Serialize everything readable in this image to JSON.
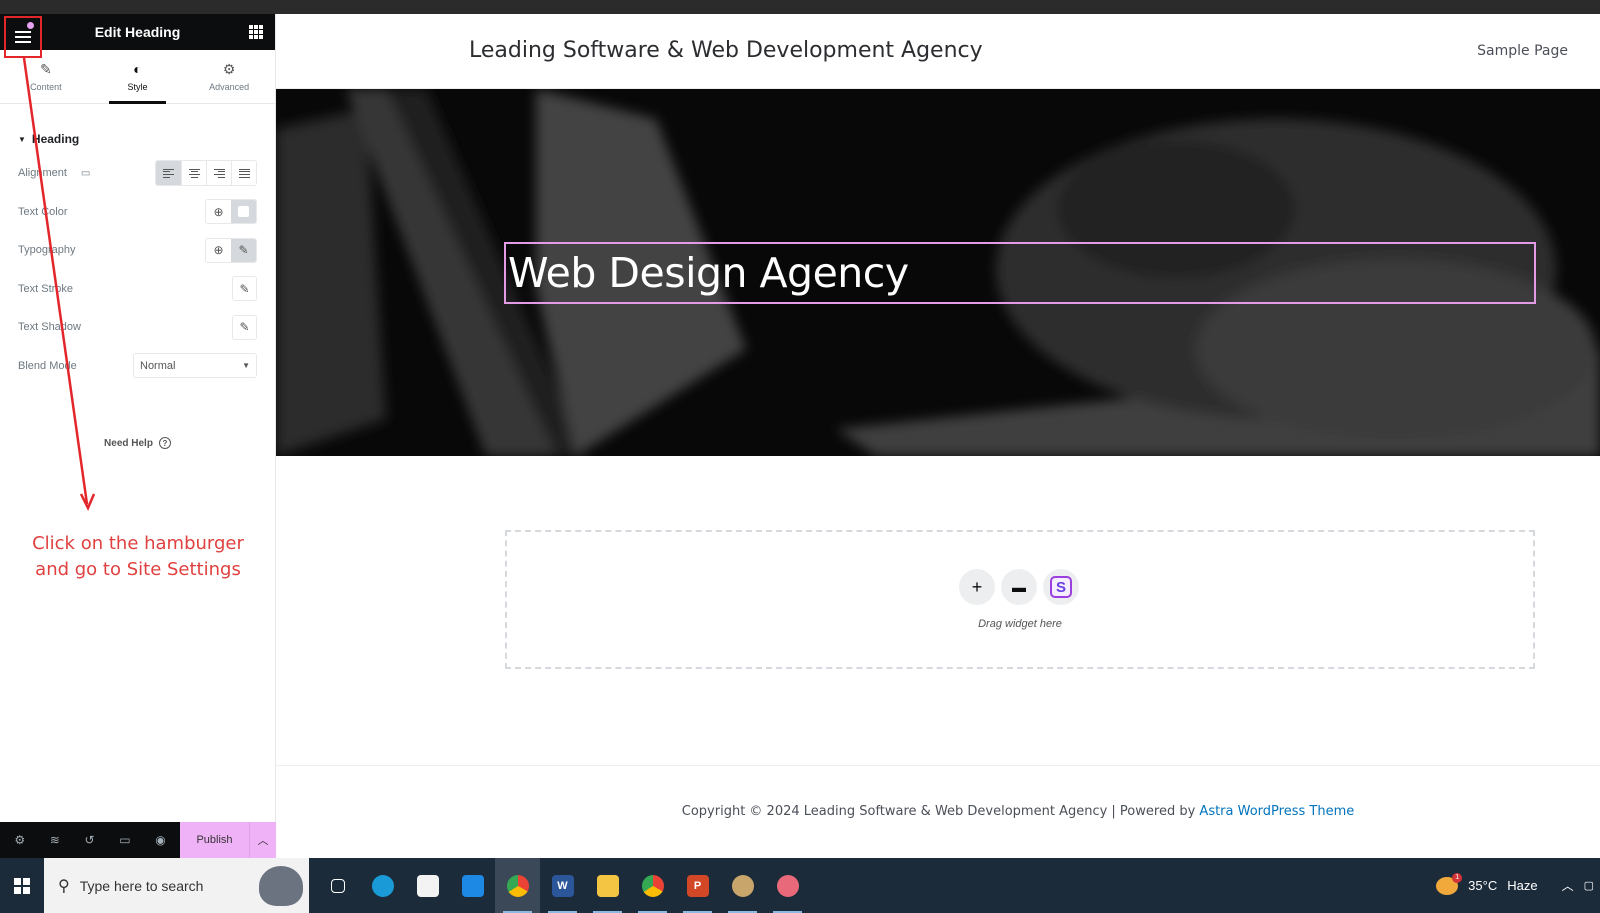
{
  "panel": {
    "title": "Edit Heading",
    "tabs": [
      {
        "label": "Content",
        "icon": "pencil-icon"
      },
      {
        "label": "Style",
        "icon": "half-circle-icon"
      },
      {
        "label": "Advanced",
        "icon": "gear-icon"
      }
    ],
    "active_tab": "Style",
    "section": "Heading",
    "controls": {
      "alignment": "Alignment",
      "text_color": "Text Color",
      "typography": "Typography",
      "text_stroke": "Text Stroke",
      "text_shadow": "Text Shadow",
      "blend_mode": "Blend Mode",
      "blend_mode_value": "Normal"
    },
    "need_help": "Need Help",
    "footer": {
      "publish": "Publish"
    }
  },
  "annotation": {
    "line1": "Click on the hamburger",
    "line2": "and go to Site Settings",
    "color": "#e0403f"
  },
  "site": {
    "title": "Leading Software & Web Development Agency",
    "nav": [
      "Sample Page"
    ],
    "hero_heading": "Web Design Agency",
    "dropzone_text": "Drag widget here",
    "footer_prefix": "Copyright © 2024 Leading Software & Web Development Agency | Powered by ",
    "footer_link": "Astra WordPress Theme"
  },
  "taskbar": {
    "search_placeholder": "Type here to search",
    "apps": [
      "Task View",
      "Edge",
      "Microsoft Store",
      "Mail",
      "Chrome",
      "Word",
      "File Explorer",
      "Chrome",
      "PowerPoint",
      "Paint",
      "Snipping Tool"
    ],
    "weather_temp": "35°C",
    "weather_cond": "Haze",
    "weather_badge": "1"
  },
  "colors": {
    "publish_bg": "#f0b2f7",
    "selection_outline": "#e39ae7",
    "link": "#0274be"
  }
}
